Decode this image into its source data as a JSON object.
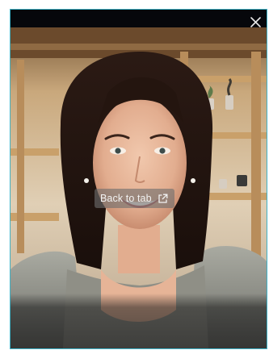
{
  "pip": {
    "back_to_tab_label": "Back to tab",
    "icons": {
      "close": "close-icon",
      "back_to_tab": "open-external-icon"
    }
  },
  "colors": {
    "frame_border": "#3fb3c8",
    "top_bar": "#06070b",
    "overlay_text": "#f2f2f2"
  }
}
